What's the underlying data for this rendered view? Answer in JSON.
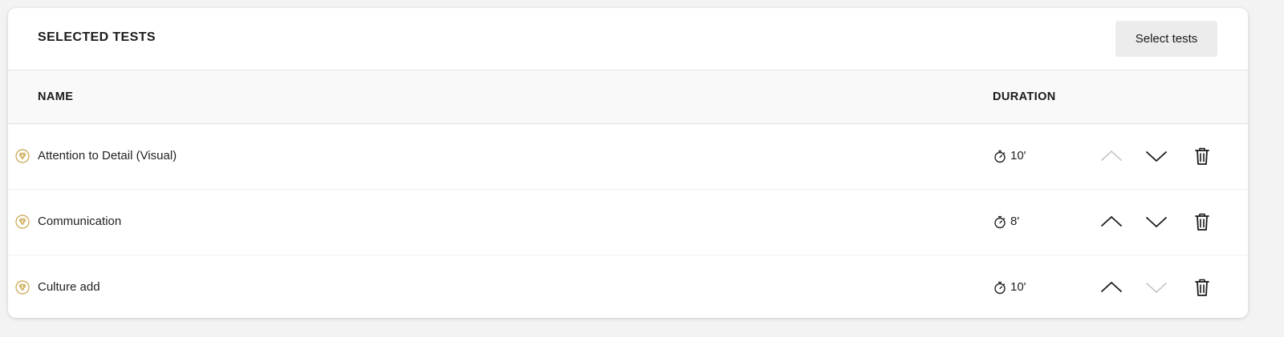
{
  "header": {
    "title": "SELECTED TESTS",
    "select_button_label": "Select tests"
  },
  "table": {
    "columns": {
      "name": "NAME",
      "duration": "DURATION"
    },
    "rows": [
      {
        "name": "Attention to Detail (Visual)",
        "duration": "10'",
        "move_up_enabled": false,
        "move_down_enabled": true
      },
      {
        "name": "Communication",
        "duration": "8'",
        "move_up_enabled": true,
        "move_down_enabled": true
      },
      {
        "name": "Culture add",
        "duration": "10'",
        "move_up_enabled": true,
        "move_down_enabled": false
      }
    ]
  },
  "icons": {
    "row_badge": "gem-icon",
    "duration": "stopwatch-icon",
    "move_up": "chevron-up-icon",
    "move_down": "chevron-down-icon",
    "delete": "trash-icon"
  },
  "colors": {
    "gem_gold": "#c9a449",
    "icon_active": "#1a1a1a",
    "icon_disabled": "#c8c8c8",
    "button_bg": "#ececec"
  }
}
